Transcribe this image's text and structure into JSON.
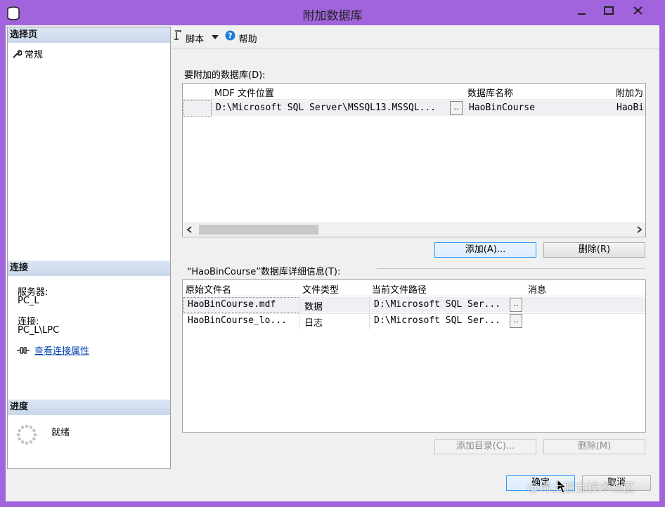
{
  "window": {
    "title": "附加数据库"
  },
  "sidebar": {
    "select_page_header": "选择页",
    "items": [
      {
        "label": "常规"
      }
    ],
    "connection_header": "连接",
    "server_label": "服务器:",
    "server_value": "PC_L",
    "connection_label": "连接:",
    "connection_value": "PC_L\\LPC",
    "view_connection_link": "查看连接属性",
    "progress_header": "进度",
    "progress_status": "就绪"
  },
  "toolbar": {
    "script_label": "脚本",
    "help_label": "帮助"
  },
  "attach_section": {
    "label": "要附加的数据库(D):",
    "columns": [
      "MDF 文件位置",
      "数据库名称",
      "附加为"
    ],
    "rows": [
      {
        "mdf": "D:\\Microsoft SQL Server\\MSSQL13.MSSQL...",
        "ellipsis": "..",
        "name": "HaoBinCourse",
        "attach_as": "HaoBi"
      }
    ],
    "add_button": "添加(A)...",
    "remove_button": "删除(R)"
  },
  "details_section": {
    "label": "“HaoBinCourse”数据库详细信息(T):",
    "columns": [
      "原始文件名",
      "文件类型",
      "当前文件路径",
      "消息"
    ],
    "rows": [
      {
        "file": "HaoBinCourse.mdf",
        "type": "数据",
        "path": "D:\\Microsoft SQL Ser...",
        "ellipsis": ".."
      },
      {
        "file": "HaoBinCourse_lo...",
        "type": "日志",
        "path": "D:\\Microsoft SQL Ser...",
        "ellipsis": ".."
      }
    ],
    "add_catalog_button": "添加目录(C)...",
    "remove_button": "删除(M)"
  },
  "footer": {
    "ok_button": "确定",
    "cancel_button": "取消"
  },
  "watermark": "@稀土掘金技术社区",
  "colors": {
    "title_bar": "#a264dc",
    "header_band": "#c9d7ea",
    "link": "#0645ad",
    "focus_border": "#3399ff"
  }
}
